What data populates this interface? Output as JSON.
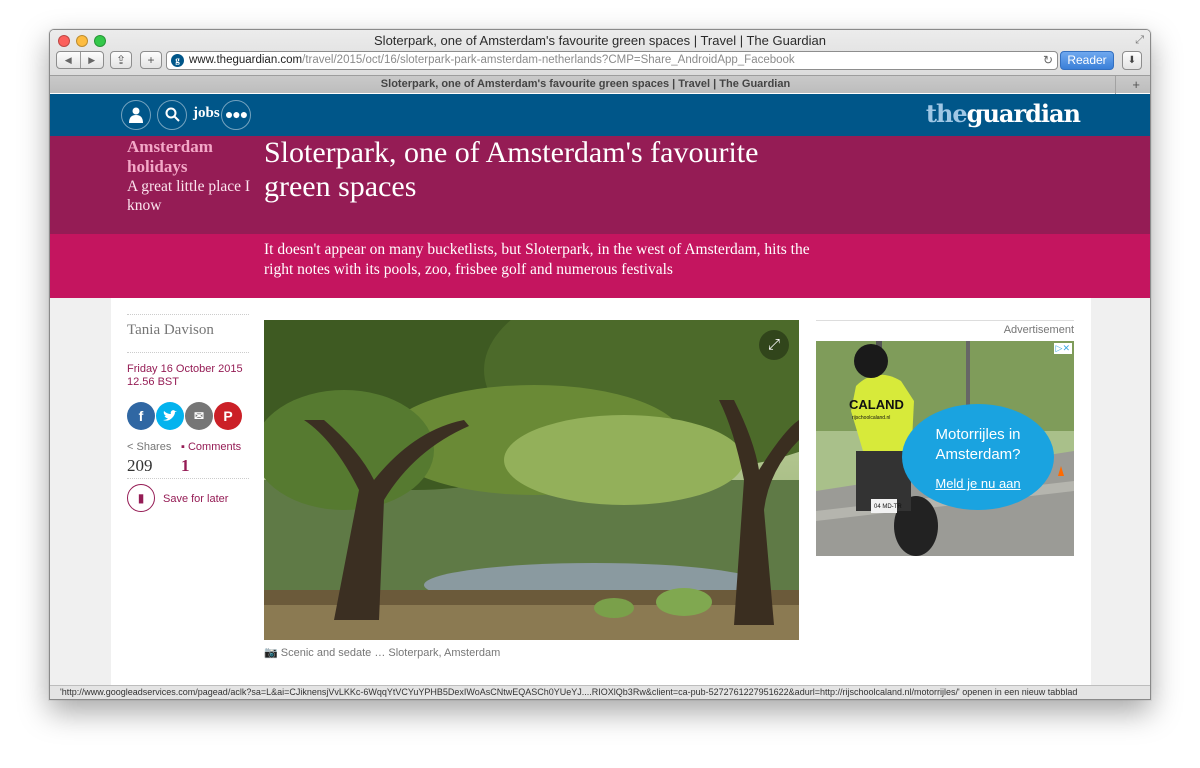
{
  "window": {
    "title": "Sloterpark, one of Amsterdam's favourite green spaces | Travel | The Guardian"
  },
  "toolbar": {
    "back_icon": "back-arrow-icon",
    "forward_icon": "forward-arrow-icon",
    "url_host": "www.theguardian.com",
    "url_path": "/travel/2015/oct/16/sloterpark-park-amsterdam-netherlands?CMP=Share_AndroidApp_Facebook",
    "reader_label": "Reader"
  },
  "tab": {
    "label": "Sloterpark, one of Amsterdam's favourite green spaces | Travel | The Guardian"
  },
  "site_nav": {
    "jobs_label": "jobs",
    "logo_the": "the",
    "logo_guardian": "guardian",
    "brand_color": "#005689"
  },
  "article": {
    "series_title": "Amsterdam holidays",
    "series_subtitle": "A great little place I know",
    "headline": "Sloterpark, one of Amsterdam's favourite green spaces",
    "standfirst": "It doesn't appear on many bucketlists, but Sloterpark, in the west of Amsterdam, hits the right notes with its pools, zoo, frisbee golf and numerous festivals",
    "byline": "Tania Davison",
    "date": "Friday 16 October 2015",
    "time": "12.56 BST",
    "shares_label": "Shares",
    "shares_count": "209",
    "comments_label": "Comments",
    "comments_count": "1",
    "save_label": "Save for later",
    "caption": "Scenic and sedate … Sloterpark, Amsterdam",
    "accent_color": "#951c55"
  },
  "ad": {
    "label": "Advertisement",
    "vest_text": "CALAND",
    "vest_subtext": "rijschoolcaland.nl",
    "plate_text": "04 MD-TR",
    "line1": "Motorrijles in",
    "line2": "Amsterdam?",
    "link": "Meld je nu aan"
  },
  "status_bar": {
    "text": "'http://www.googleadservices.com/pagead/aclk?sa=L&ai=CJiknensjVvLKKc-6WqqYtVCYuYPHB5DexIWoAsCNtwEQASCh0YUeYJ....RIOXlQb3Rw&client=ca-pub-5272761227951622&adurl=http://rijschoolcaland.nl/motorrijles/' openen in een nieuw tabblad"
  }
}
